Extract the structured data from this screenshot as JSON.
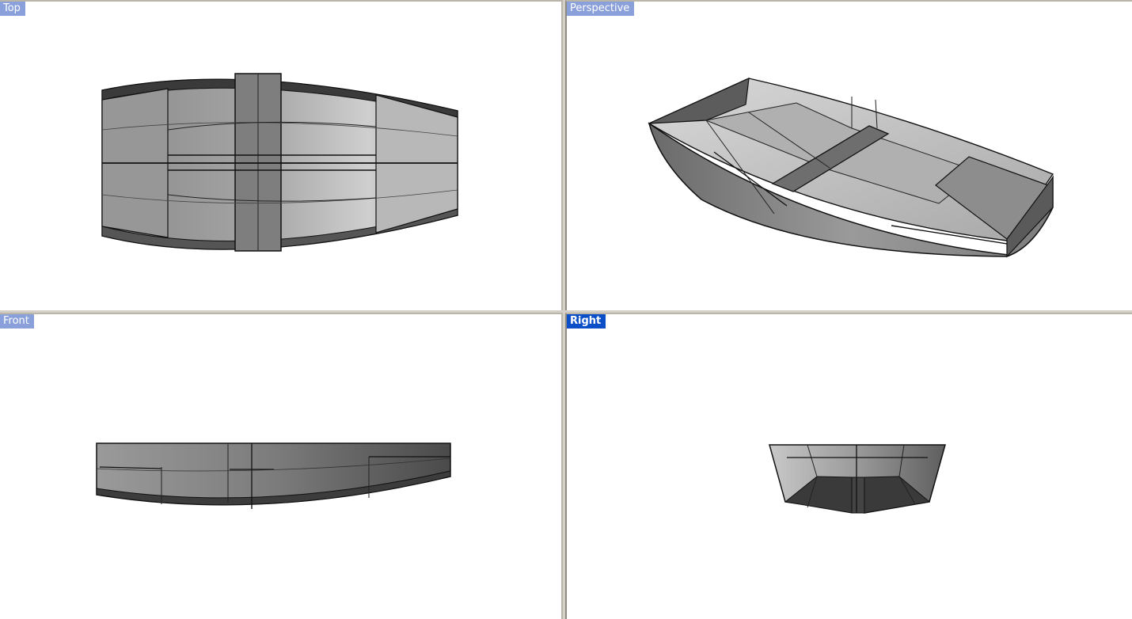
{
  "viewports": {
    "top": {
      "label": "Top",
      "active": false
    },
    "perspective": {
      "label": "Perspective",
      "active": false
    },
    "front": {
      "label": "Front",
      "active": false
    },
    "right": {
      "label": "Right",
      "active": true
    }
  },
  "colors": {
    "background": "#ffffff",
    "frame": "#d4d0c8",
    "label_inactive": "#8aa0da",
    "label_active": "#0a4fc8",
    "hull_dark": "#3c3c3c",
    "hull_mid": "#8c8c8c",
    "hull_light": "#d2d2d2"
  }
}
